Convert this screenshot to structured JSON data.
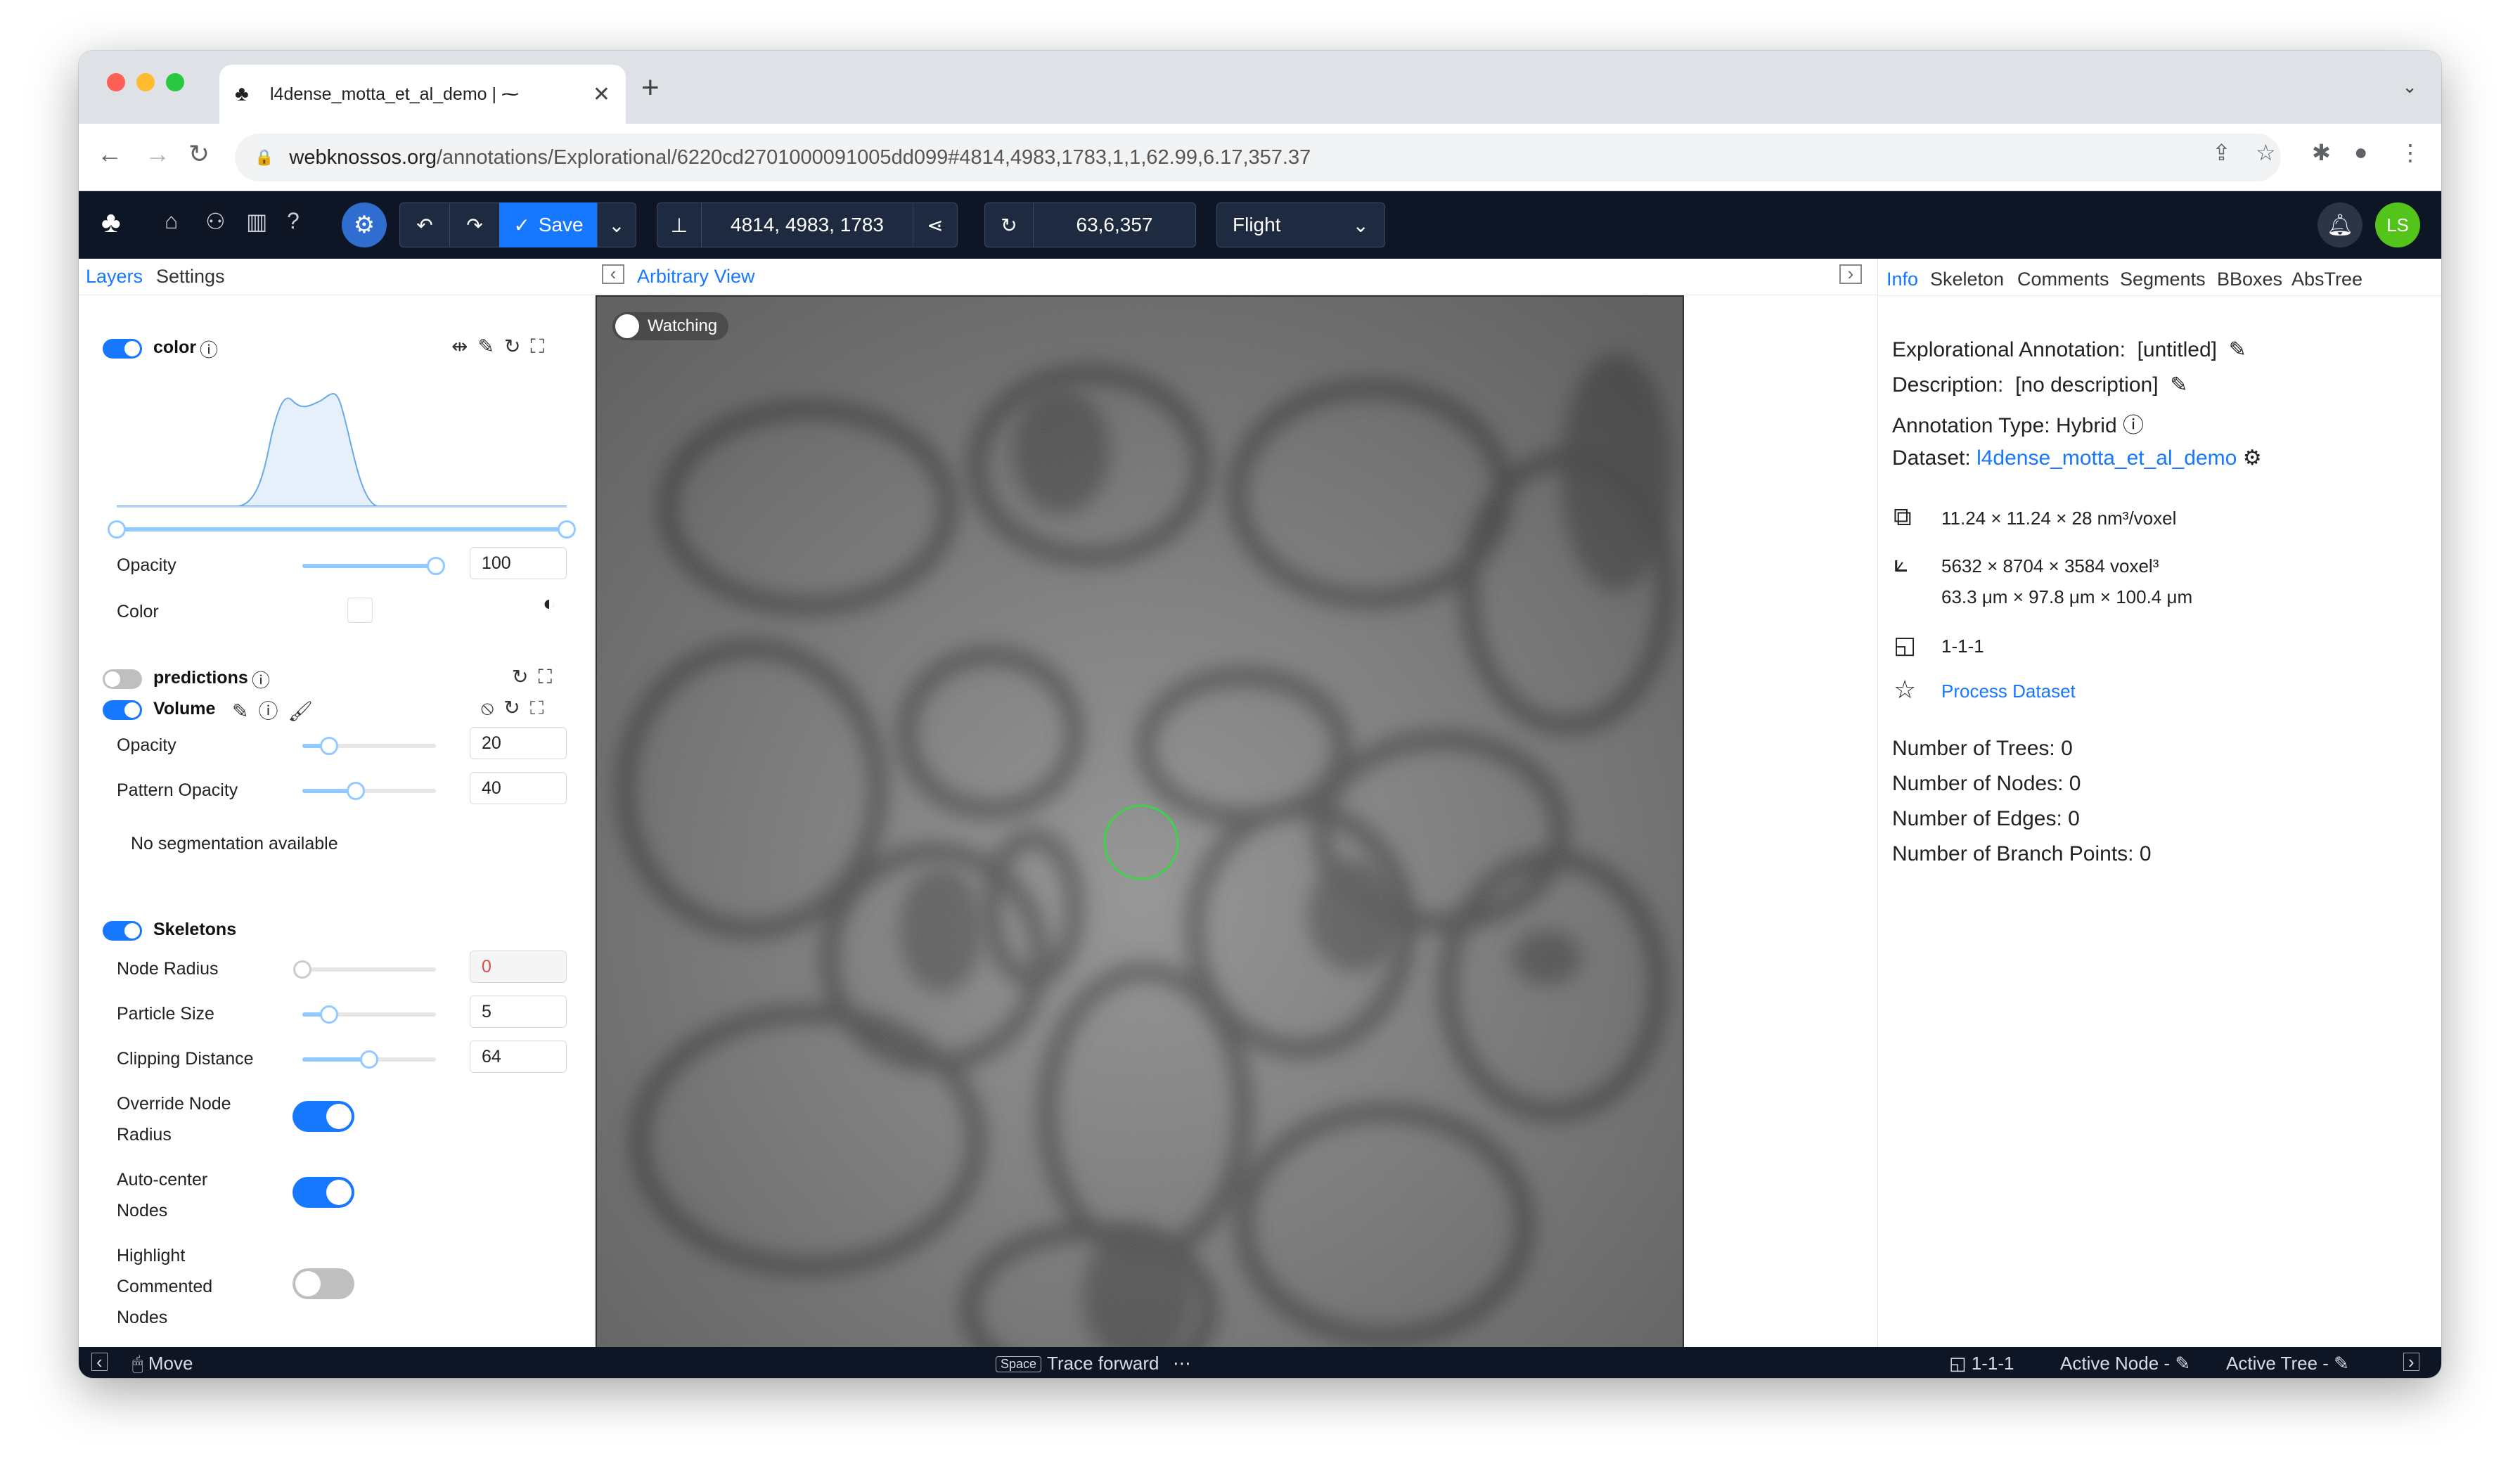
{
  "browser": {
    "tab_title": "l4dense_motta_et_al_demo | ⁓",
    "url_host": "webknossos.org",
    "url_path": "/annotations/Explorational/6220cd2701000091005dd099#4814,4983,1783,1,1,62.99,6.17,357.37"
  },
  "appbar": {
    "save_label": "Save",
    "position_value": "4814, 4983, 1783",
    "rotation_value": "63,6,357",
    "mode_value": "Flight",
    "avatar_initials": "LS"
  },
  "left_tabs": {
    "layers": "Layers",
    "settings": "Settings"
  },
  "viewport": {
    "title": "Arbitrary View",
    "watching_label": "Watching"
  },
  "color_layer": {
    "name": "color",
    "opacity_label": "Opacity",
    "opacity_value": "100",
    "opacity_fraction": 1.0,
    "color_label": "Color"
  },
  "predictions_layer": {
    "name": "predictions"
  },
  "volume_layer": {
    "name": "Volume",
    "opacity_label": "Opacity",
    "opacity_value": "20",
    "opacity_fraction": 0.2,
    "pattern_label": "Pattern Opacity",
    "pattern_value": "40",
    "pattern_fraction": 0.4,
    "no_seg": "No segmentation available"
  },
  "skeletons": {
    "title": "Skeletons",
    "node_radius_label": "Node Radius",
    "node_radius_value": "0",
    "node_radius_fraction": 0.0,
    "particle_label": "Particle Size",
    "particle_value": "5",
    "particle_fraction": 0.2,
    "clipping_label": "Clipping Distance",
    "clipping_value": "64",
    "clipping_fraction": 0.5,
    "override_line1": "Override Node",
    "override_line2": "Radius",
    "autocenter_line1": "Auto-center",
    "autocenter_line2": "Nodes",
    "highlight_line1": "Highlight",
    "highlight_line2": "Commented",
    "highlight_line3": "Nodes"
  },
  "right_tabs": [
    "Info",
    "Skeleton",
    "Comments",
    "Segments",
    "BBoxes",
    "AbsTree"
  ],
  "info": {
    "annotation_label": "Explorational Annotation:",
    "annotation_value": "[untitled]",
    "description_label": "Description:",
    "description_value": "[no description]",
    "type_label": "Annotation Type:",
    "type_value": "Hybrid",
    "dataset_label": "Dataset:",
    "dataset_value": "l4dense_motta_et_al_demo",
    "voxel_size": "11.24 × 11.24 × 28 nm³/voxel",
    "extent_voxels": "5632 × 8704 × 3584 voxel³",
    "extent_um": "63.3 μm × 97.8 μm × 100.4 μm",
    "resolution": "1-1-1",
    "process_link": "Process Dataset",
    "trees": "Number of Trees: 0",
    "nodes": "Number of Nodes: 0",
    "edges": "Number of Edges: 0",
    "branchpoints": "Number of Branch Points: 0"
  },
  "statusbar": {
    "move": "Move",
    "space_key": "Space",
    "trace": "Trace forward",
    "more": "⋯",
    "resolution": "1-1-1",
    "active_node": "Active Node -",
    "active_tree": "Active Tree -"
  },
  "colors": {
    "accent": "#1677ff",
    "navbar": "#0e1525",
    "avatar": "#52c41a"
  }
}
